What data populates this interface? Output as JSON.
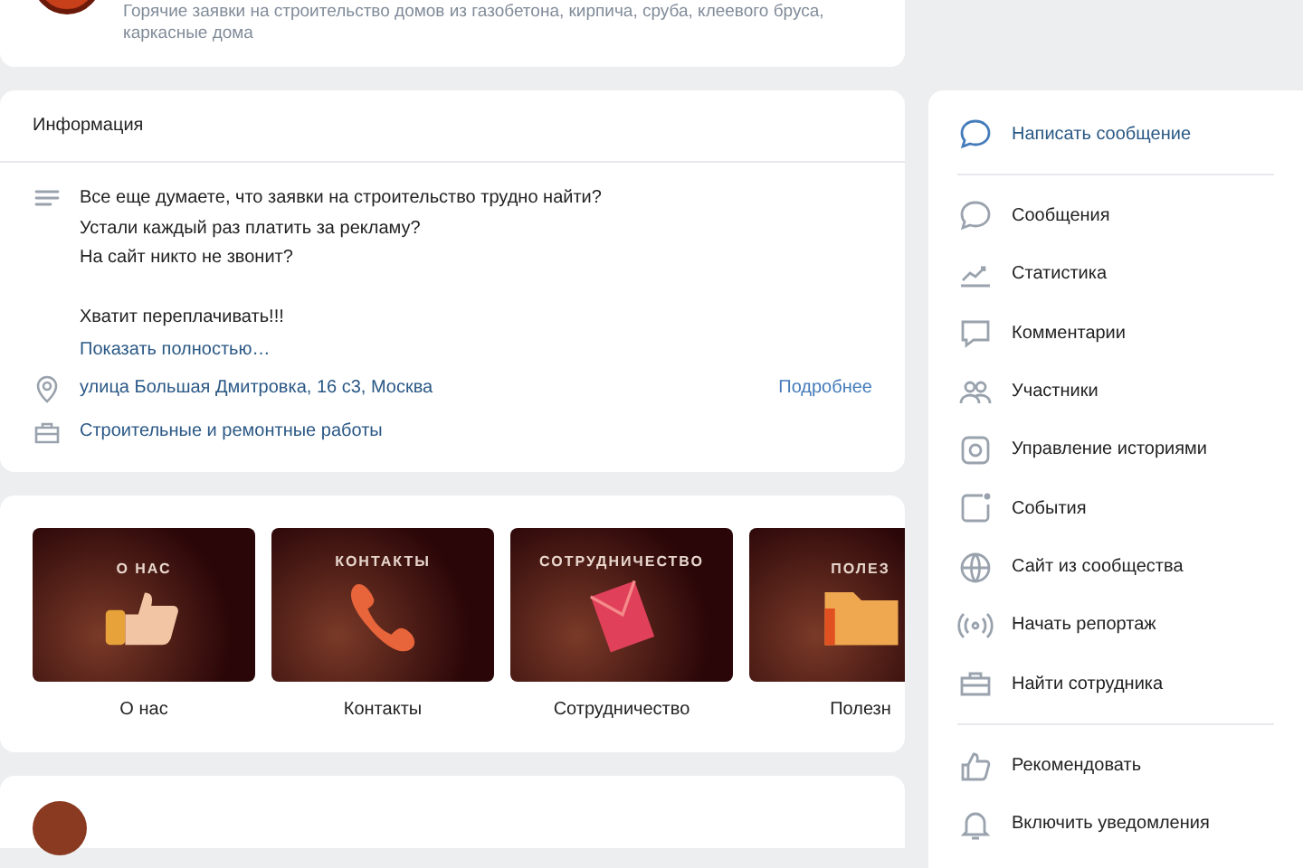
{
  "header": {
    "description": "Горячие заявки на строительство домов из газобетона, кирпича, сруба, клеевого бруса, каркасные дома"
  },
  "info": {
    "title": "Информация",
    "description": "Все еще думаете, что заявки на строительство трудно найти?\nУстали каждый раз платить за рекламу?\nНа сайт никто не звонит?\n\nХватит переплачивать!!!",
    "show_more": "Показать полностью…",
    "address": "улица Большая Дмитровка, 16 с3, Москва",
    "address_more": "Подробнее",
    "category": "Строительные и ремонтные работы"
  },
  "menu_tiles": [
    {
      "image_text": "О НАС",
      "caption": "О нас"
    },
    {
      "image_text": "КОНТАКТЫ",
      "caption": "Контакты"
    },
    {
      "image_text": "СОТРУДНИЧЕСТВО",
      "caption": "Сотрудничество"
    },
    {
      "image_text": "ПОЛЕЗ",
      "caption": "Полезн"
    }
  ],
  "sidebar": {
    "sections": [
      {
        "kind": "action",
        "items": [
          "Написать сообщение"
        ]
      },
      {
        "kind": "plain",
        "items": [
          "Сообщения",
          "Статистика",
          "Комментарии",
          "Участники",
          "Управление историями",
          "События",
          "Сайт из сообщества",
          "Начать репортаж",
          "Найти сотрудника"
        ]
      },
      {
        "kind": "plain",
        "items": [
          "Рекомендовать",
          "Включить уведомления"
        ]
      }
    ]
  }
}
